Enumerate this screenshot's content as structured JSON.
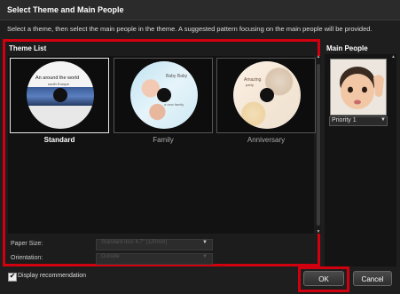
{
  "dialog": {
    "title": "Select Theme and Main People",
    "instruction": "Select a theme, then select the main people in the theme. A suggested pattern focusing on the main people will be provided."
  },
  "theme_list": {
    "label": "Theme List",
    "themes": [
      {
        "name": "Standard",
        "selected": true,
        "disc_text": "An around the world",
        "disc_subtext": "south Europe"
      },
      {
        "name": "Family",
        "selected": false,
        "disc_text": "Baby Baby",
        "disc_subtext": "a new family"
      },
      {
        "name": "Anniversary",
        "selected": false,
        "disc_text": "Amazing",
        "disc_subtext": "party"
      }
    ]
  },
  "settings": {
    "paper_size_label": "Paper Size:",
    "paper_size_value": "Standard disc 4.7\" (120mm)",
    "orientation_label": "Orientation:",
    "orientation_value": "Outside"
  },
  "main_people": {
    "label": "Main People",
    "priority_value": "Priority 1"
  },
  "footer": {
    "display_recommendation_label": "Display recommendation",
    "display_recommendation_checked": true,
    "ok_label": "OK",
    "cancel_label": "Cancel"
  },
  "colors": {
    "highlight": "#d1000f",
    "background": "#1e1e1e"
  }
}
